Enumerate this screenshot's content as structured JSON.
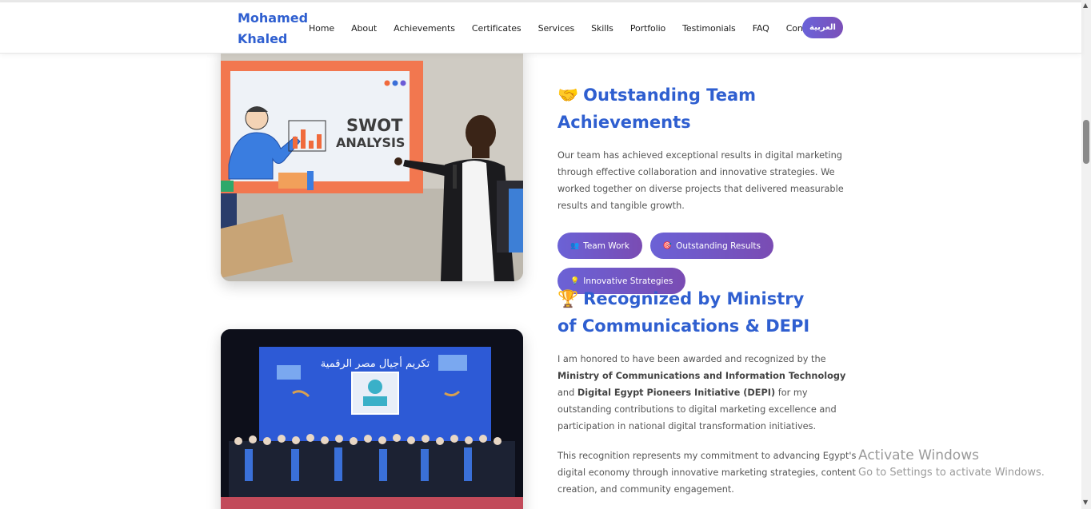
{
  "brand": {
    "name_line1": "Mohamed",
    "name_line2": "Khaled"
  },
  "nav": {
    "items": [
      "Home",
      "About",
      "Achievements",
      "Certificates",
      "Services",
      "Skills",
      "Portfolio",
      "Testimonials",
      "FAQ",
      "Contact"
    ],
    "lang_button": "العربية"
  },
  "photo1": {
    "slide_text_line1": "SWOT",
    "slide_text_line2": "ANALYSIS"
  },
  "photo2": {
    "banner_text": "تكريم أجيال مصر الرقمية"
  },
  "section1": {
    "emoji": "🤝",
    "title": "Outstanding Team Achievements",
    "paragraph": "Our team has achieved exceptional results in digital marketing through effective collaboration and innovative strategies. We worked together on diverse projects that delivered measurable results and tangible growth.",
    "tags": [
      {
        "icon": "👥",
        "label": "Team Work"
      },
      {
        "icon": "🎯",
        "label": "Outstanding Results"
      },
      {
        "icon": "💡",
        "label": "Innovative Strategies"
      }
    ]
  },
  "section2": {
    "emoji": "🏆",
    "title": "Recognized by Ministry of Communications & DEPI",
    "p1_a": "I am honored to have been awarded and recognized by the ",
    "p1_b": "Ministry of Communications and Information Technology",
    "p1_c": " and ",
    "p1_d": "Digital Egypt Pioneers Initiative (DEPI)",
    "p1_e": " for my outstanding contributions to digital marketing excellence and participation in national digital transformation initiatives.",
    "p2": "This recognition represents my commitment to advancing Egypt's digital economy through innovative marketing strategies, content creation, and community engagement."
  },
  "watermark": {
    "line1": "Activate Windows",
    "line2": "Go to Settings to activate Windows."
  },
  "colors": {
    "accent": "#2f5fd0",
    "tag_gradient_start": "#6b62d6",
    "tag_gradient_end": "#7a4cb3"
  },
  "icons": {
    "scroll_up": "triangle-up",
    "scroll_down": "triangle-down"
  }
}
